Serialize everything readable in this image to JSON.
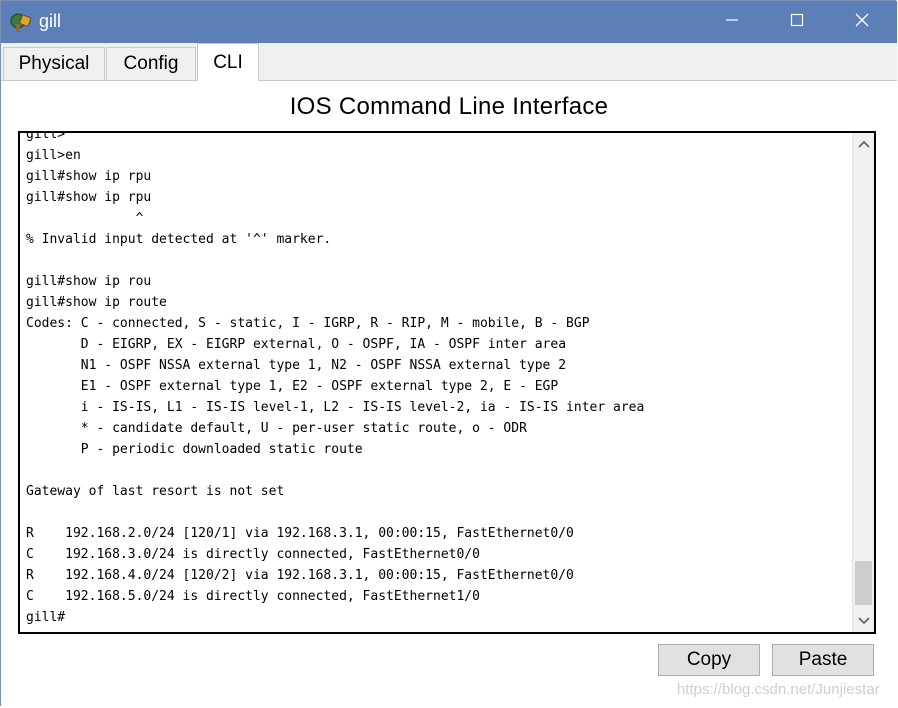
{
  "window": {
    "title": "gill",
    "icon": "router-config-icon",
    "controls": [
      "minimize-icon",
      "maximize-icon",
      "close-icon"
    ]
  },
  "tabs": {
    "physical": "Physical",
    "config": "Config",
    "cli": "CLI",
    "active": "CLI"
  },
  "cli": {
    "heading": "IOS Command Line Interface",
    "lines": [
      "gill>",
      "gill>en",
      "gill#show ip rpu",
      "gill#show ip rpu",
      "              ^",
      "% Invalid input detected at '^' marker.",
      "",
      "gill#show ip rou",
      "gill#show ip route",
      "Codes: C - connected, S - static, I - IGRP, R - RIP, M - mobile, B - BGP",
      "       D - EIGRP, EX - EIGRP external, O - OSPF, IA - OSPF inter area",
      "       N1 - OSPF NSSA external type 1, N2 - OSPF NSSA external type 2",
      "       E1 - OSPF external type 1, E2 - OSPF external type 2, E - EGP",
      "       i - IS-IS, L1 - IS-IS level-1, L2 - IS-IS level-2, ia - IS-IS inter area",
      "       * - candidate default, U - per-user static route, o - ODR",
      "       P - periodic downloaded static route",
      "",
      "Gateway of last resort is not set",
      "",
      "R    192.168.2.0/24 [120/1] via 192.168.3.1, 00:00:15, FastEthernet0/0",
      "C    192.168.3.0/24 is directly connected, FastEthernet0/0",
      "R    192.168.4.0/24 [120/2] via 192.168.3.1, 00:00:15, FastEthernet0/0",
      "C    192.168.5.0/24 is directly connected, FastEthernet1/0",
      "gill#"
    ]
  },
  "buttons": {
    "copy": "Copy",
    "paste": "Paste"
  },
  "watermark": "https://blog.csdn.net/Junjiestar",
  "colors": {
    "titlebar": "#5b7fb6",
    "tab_background": "#f0f0f0",
    "button_background": "#e1e1e1"
  }
}
